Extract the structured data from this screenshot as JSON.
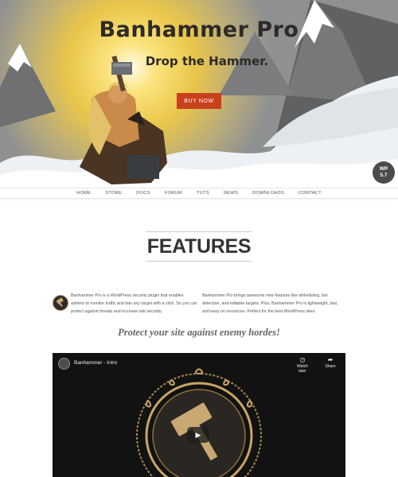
{
  "hero": {
    "title": "Banhammer Pro",
    "tagline": "Drop the Hammer.",
    "buy_button": "BUY NOW",
    "wp_badge": {
      "line1": "WP",
      "line2": "5.7"
    }
  },
  "nav": {
    "items": [
      "HOME",
      "STORE",
      "DOCS",
      "FORUM",
      "TUTS",
      "NEWS",
      "DOWNLOADS",
      "CONTACT"
    ]
  },
  "features": {
    "title": "FEATURES",
    "col1": "Banhammer Pro is a WordPress security plugin that enables admins to monitor traffic and ban any target with a click. So you can protect against threats and increase site security.",
    "col2": "Banhammer Pro brings awesome new features like whitelisting, bot detection, and editable targets. Plus, Banhammer Pro is lightweight, fast, and easy on resources. Perfect for the best WordPress sites.",
    "icon": "hammer-badge-icon"
  },
  "subheading": "Protect your site against enemy hordes!",
  "video": {
    "title": "Banhammer - Intro",
    "watch_later": "Watch later",
    "share": "Share",
    "icons": {
      "watch_later": "clock-icon",
      "share": "share-arrow-icon",
      "play": "play-icon"
    }
  },
  "colors": {
    "accent": "#c9401c",
    "sun": "#f6d44a",
    "gold": "#b89968",
    "video_bg": "#121212"
  }
}
